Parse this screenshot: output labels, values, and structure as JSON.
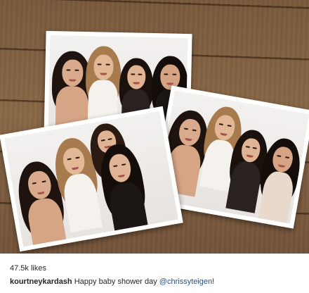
{
  "post": {
    "likes": "47.5k likes",
    "username": "kourtneykardash",
    "caption_text": " Happy baby shower day ",
    "mention": "@chrissyteigen",
    "caption_end": "!"
  },
  "colors": {
    "wood": "#8a6947",
    "print_bg": "#f3f1ef",
    "mention": "#2b4f7e",
    "text": "#262626"
  }
}
